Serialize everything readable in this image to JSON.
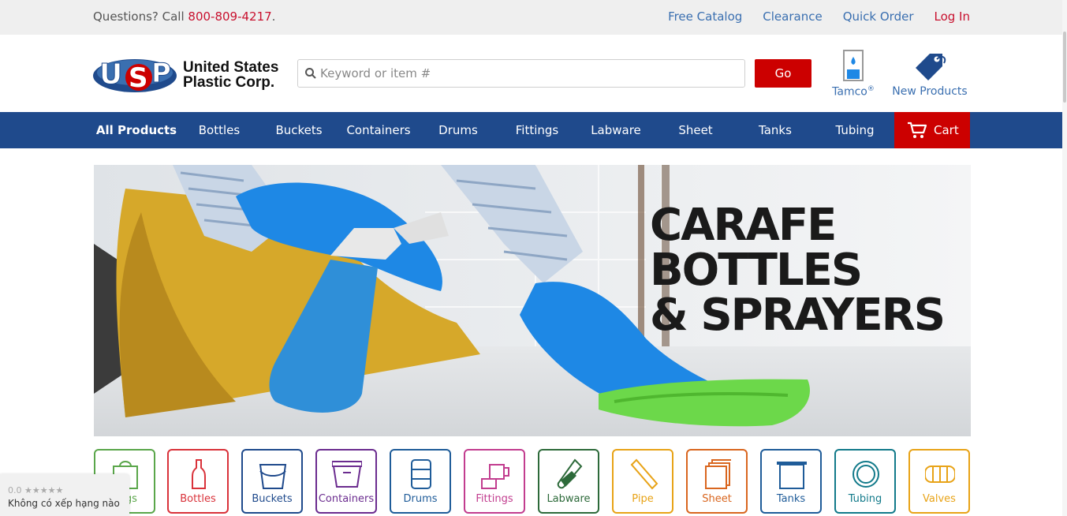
{
  "topbar": {
    "questions_text": "Questions? Call ",
    "phone": "800-809-4217",
    "phone_suffix": ".",
    "links": {
      "free_catalog": "Free Catalog",
      "clearance": "Clearance",
      "quick_order": "Quick Order",
      "log_in": "Log In"
    }
  },
  "header": {
    "logo_text_line1": "United States",
    "logo_text_line2": "Plastic Corp.",
    "search_placeholder": "Keyword or item #",
    "search_value": "",
    "go_label": "Go",
    "tamco_label": "Tamco",
    "tamco_reg": "®",
    "new_products_label": "New Products"
  },
  "nav": {
    "items": [
      "All Products",
      "Bottles",
      "Buckets",
      "Containers",
      "Drums",
      "Fittings",
      "Labware",
      "Sheet",
      "Tanks",
      "Tubing"
    ],
    "cart_label": "Cart"
  },
  "hero": {
    "line1": "CARAFE",
    "line2": "BOTTLES",
    "line3": "& SPRAYERS"
  },
  "categories": [
    {
      "label": "Bags",
      "color": "#5aa64a",
      "icon": "bag-icon"
    },
    {
      "label": "Bottles",
      "color": "#d9323a",
      "icon": "bottle-icon"
    },
    {
      "label": "Buckets",
      "color": "#1f4a8c",
      "icon": "bucket-icon"
    },
    {
      "label": "Containers",
      "color": "#6b2c8f",
      "icon": "container-icon"
    },
    {
      "label": "Drums",
      "color": "#1f5c99",
      "icon": "drum-icon"
    },
    {
      "label": "Fittings",
      "color": "#c23d8f",
      "icon": "fitting-icon"
    },
    {
      "label": "Labware",
      "color": "#2d6a3a",
      "icon": "flask-icon"
    },
    {
      "label": "Pipe",
      "color": "#e8a317",
      "icon": "pipe-icon"
    },
    {
      "label": "Sheet",
      "color": "#d9661f",
      "icon": "sheet-icon"
    },
    {
      "label": "Tanks",
      "color": "#1f5c99",
      "icon": "tank-icon"
    },
    {
      "label": "Tubing",
      "color": "#127a8a",
      "icon": "tubing-icon"
    },
    {
      "label": "Valves",
      "color": "#e8a317",
      "icon": "valve-icon"
    }
  ],
  "rating_widget": {
    "score": "0.0",
    "stars": "★★★★★",
    "text": "Không có xếp hạng nào"
  },
  "colors": {
    "brand_blue": "#1f4a8c",
    "brand_red": "#cc0000",
    "link_blue": "#3a6fb0"
  }
}
